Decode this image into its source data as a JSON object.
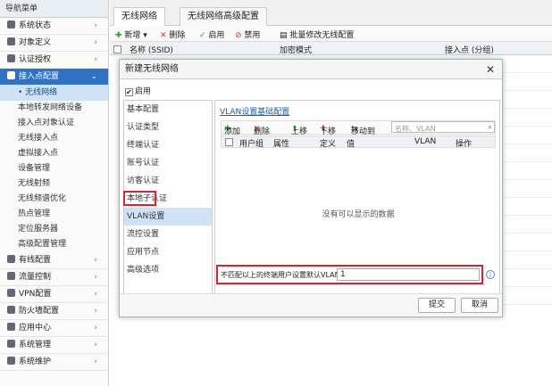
{
  "sidebar": {
    "header": "导航菜单",
    "items": [
      {
        "label": "系统状态",
        "icon": "monitor-icon"
      },
      {
        "label": "对象定义",
        "icon": "object-icon"
      },
      {
        "label": "认证授权",
        "icon": "auth-icon"
      },
      {
        "label": "接入点配置",
        "icon": "ap-icon",
        "active": true
      }
    ],
    "subitems": [
      {
        "label": "• 无线网络",
        "selected": true
      },
      {
        "label": "本地转发网络设备"
      },
      {
        "label": "接入点对象认证"
      },
      {
        "label": "无线接入点"
      },
      {
        "label": "虚拟接入点"
      },
      {
        "label": "设备管理"
      },
      {
        "label": "无线射频"
      },
      {
        "label": "无线频谱优化"
      },
      {
        "label": "热点管理"
      },
      {
        "label": "定位服务器"
      },
      {
        "label": "高级配置管理"
      }
    ],
    "bottom_items": [
      {
        "label": "有线配置",
        "icon": "wired-icon"
      },
      {
        "label": "流量控制",
        "icon": "traffic-icon"
      },
      {
        "label": "VPN配置",
        "icon": "vpn-icon"
      },
      {
        "label": "防火墙配置",
        "icon": "firewall-icon"
      },
      {
        "label": "应用中心",
        "icon": "app-center-icon"
      },
      {
        "label": "系统管理",
        "icon": "gear-icon"
      },
      {
        "label": "系统维护",
        "icon": "wrench-icon"
      }
    ]
  },
  "tabs": [
    {
      "label": "无线网络",
      "active": true
    },
    {
      "label": "无线网络高级配置",
      "active": false
    }
  ],
  "toolbar": {
    "add": "新增",
    "delete": "删除",
    "enable": "启用",
    "disable": "禁用",
    "batch": "批量修改无线配置"
  },
  "table": {
    "col_name": "名称 (SSID)",
    "col_enc": "加密模式",
    "col_ap": "接入点 (分组)"
  },
  "dialog": {
    "title": "新建无线网络",
    "close": "✕",
    "enable_label": "启用",
    "nav": [
      "基本配置",
      "认证类型",
      "终端认证",
      "账号认证",
      "访客认证",
      "本地子认证",
      "VLAN设置",
      "流控设置",
      "应用节点",
      "高级选项"
    ],
    "nav_selected": 6,
    "vlan_link": "VLAN设置基础配置",
    "ptool": {
      "add": "添加",
      "delete": "删除",
      "up": "上移",
      "down": "下移",
      "move": "移动到",
      "search_placeholder": "名称、VLAN"
    },
    "pcols": {
      "name": "用户组",
      "attr": "属性",
      "def": "定义",
      "value": "值",
      "vlan": "VLAN",
      "op": "操作"
    },
    "empty_text": "没有可以显示的数据",
    "default_label": "不匹配以上的终端用户设置默认VLAN",
    "default_value": "1",
    "info": "i",
    "ok": "提交",
    "cancel": "取消"
  }
}
